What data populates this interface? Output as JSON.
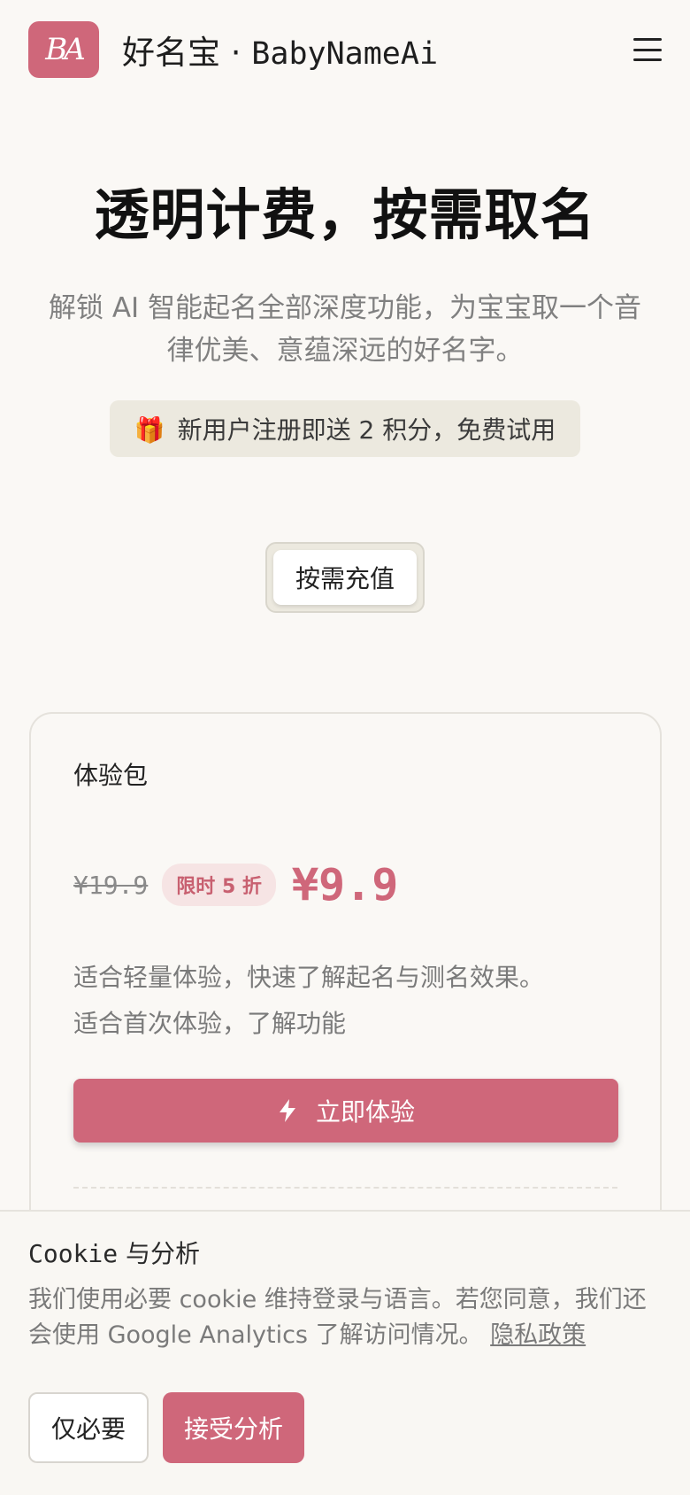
{
  "header": {
    "logo_text": "BA",
    "brand_cn": "好名宝",
    "brand_sep": " · ",
    "brand_en": "BabyNameAi"
  },
  "hero": {
    "title": "透明计费，按需取名",
    "subtitle": "解锁 AI 智能起名全部深度功能，为宝宝取一个音律优美、意蕴深远的好名字。",
    "gift_icon": "🎁",
    "gift_text": "新用户注册即送 2 积分，免费试用"
  },
  "recharge": {
    "label": "按需充值"
  },
  "plan": {
    "name": "体验包",
    "original_price": "¥19.9",
    "discount": "限时 5 折",
    "price": "¥9.9",
    "desc_line1": "适合轻量体验，快速了解起名与测名效果。",
    "desc_line2": "适合首次体验，了解功能",
    "cta_label": "立即体验"
  },
  "cookie": {
    "title_mono": "Cookie",
    "title_rest": " 与分析",
    "text": "我们使用必要 cookie 维持登录与语言。若您同意，我们还会使用 Google Analytics 了解访问情况。 ",
    "privacy_link": "隐私政策",
    "necessary_label": "仅必要",
    "accept_label": "接受分析"
  },
  "colors": {
    "accent": "#cf677a",
    "background": "#faf8f5",
    "muted_text": "#7a7a7a"
  },
  "icons": {
    "menu": "hamburger-menu-icon",
    "gift": "gift-icon",
    "cta": "lightning-bolt-icon"
  }
}
